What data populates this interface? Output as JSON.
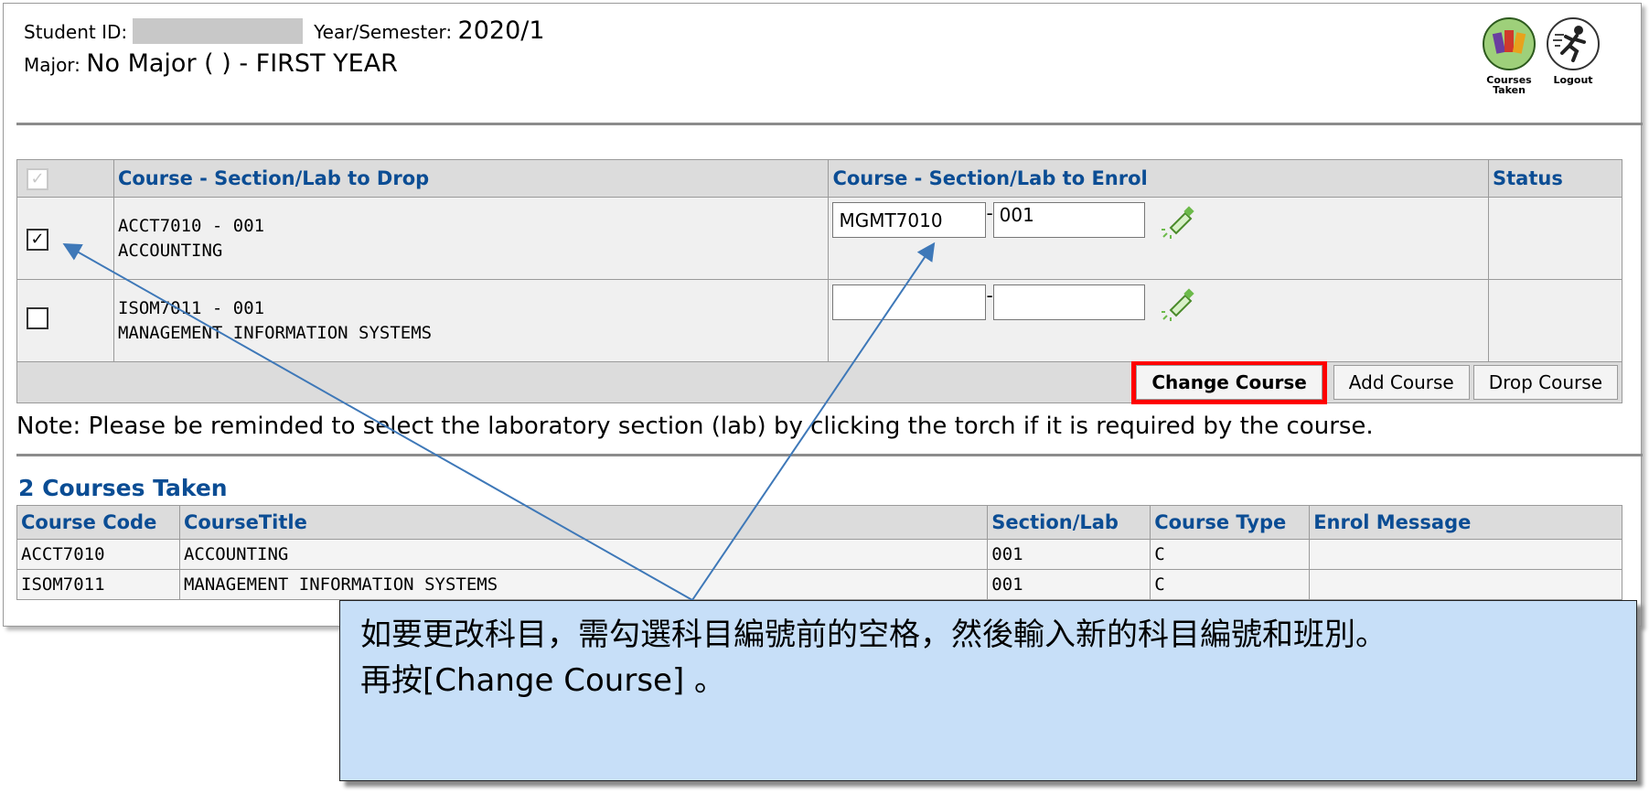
{
  "header": {
    "student_id_label": "Student ID:",
    "year_semester_label": "Year/Semester:",
    "year_semester_value": "2020/1",
    "major_label": "Major:",
    "major_value": "No Major ( ) - FIRST YEAR",
    "courses_taken_icon_label": "Courses Taken",
    "logout_icon_label": "Logout"
  },
  "enrol_table": {
    "columns": [
      "Course - Section/Lab to Drop",
      "Course - Section/Lab to Enrol",
      "Status"
    ],
    "rows": [
      {
        "checked": true,
        "drop_code": "ACCT7010 - 001",
        "drop_title": "ACCOUNTING",
        "enrol_course": "MGMT7010",
        "enrol_section": "001",
        "status": ""
      },
      {
        "checked": false,
        "drop_code": "ISOM7011 - 001",
        "drop_title": "MANAGEMENT INFORMATION SYSTEMS",
        "enrol_course": "",
        "enrol_section": "",
        "status": ""
      }
    ],
    "buttons": {
      "change": "Change Course",
      "add": "Add Course",
      "drop": "Drop Course"
    }
  },
  "note": "Note: Please be reminded to select the laboratory section (lab) by clicking the torch if it is required by the course.",
  "courses_taken": {
    "title": "2 Courses Taken",
    "columns": [
      "Course Code",
      "CourseTitle",
      "Section/Lab",
      "Course Type",
      "Enrol Message"
    ],
    "rows": [
      [
        "ACCT7010",
        "ACCOUNTING",
        "001",
        "C",
        ""
      ],
      [
        "ISOM7011",
        "MANAGEMENT INFORMATION SYSTEMS",
        "001",
        "C",
        ""
      ]
    ]
  },
  "callout": {
    "line1": "如要更改科目，需勾選科目編號前的空格，然後輸入新的科目編號和班別。",
    "line2": "再按[Change Course] 。"
  },
  "colors": {
    "header_text": "#0b4d94",
    "highlight_border": "#ff0000",
    "callout_bg": "#c7dff8",
    "arrow": "#3e78b8"
  }
}
